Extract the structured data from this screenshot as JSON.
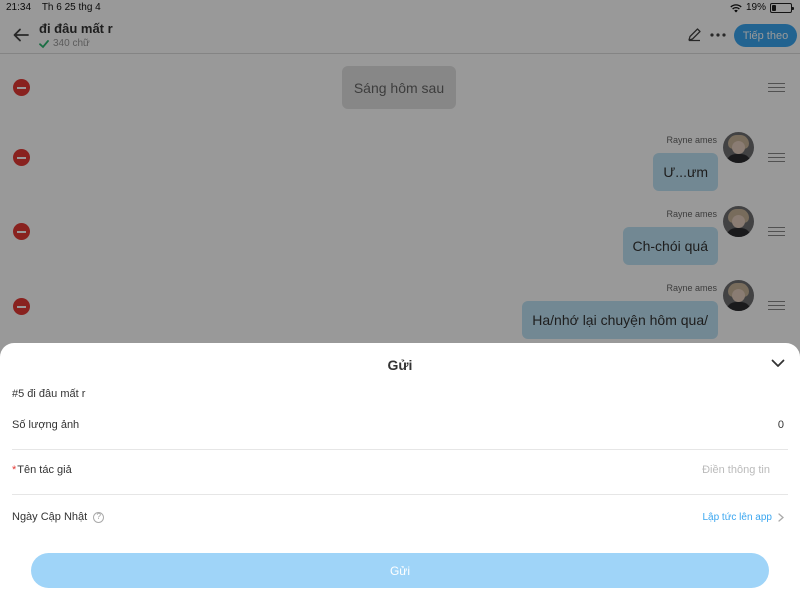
{
  "status_bar": {
    "time": "21:34",
    "date": "Th 6 25 thg 4",
    "battery": "19%"
  },
  "header": {
    "title": "đi đâu mất r",
    "word_count": "340 chữ",
    "next_label": "Tiếp theo"
  },
  "chat": {
    "narration": "Sáng hôm sau",
    "messages": [
      {
        "sender": "Rayne ames",
        "text": "Ư...ưm"
      },
      {
        "sender": "Rayne ames",
        "text": "Ch-chói quá"
      },
      {
        "sender": "Rayne ames",
        "text": "Ha/nhớ lại chuyện hôm qua/"
      }
    ]
  },
  "sheet": {
    "title": "Gửi",
    "chapter": "#5 đi đâu mất r",
    "image_count_label": "Số lượng ảnh",
    "image_count_value": "0",
    "required_mark": "*",
    "author_label": "Tên tác giả",
    "author_placeholder": "Điền thông tin",
    "update_date_label": "Ngày Cập Nhật",
    "help_glyph": "?",
    "update_value": "Lập tức lên app",
    "submit_label": "Gửi"
  },
  "colors": {
    "accent": "#3aa6f0",
    "submit_disabled": "#9fd4f8",
    "delete": "#e53935",
    "bubble": "#bfe3f5"
  }
}
